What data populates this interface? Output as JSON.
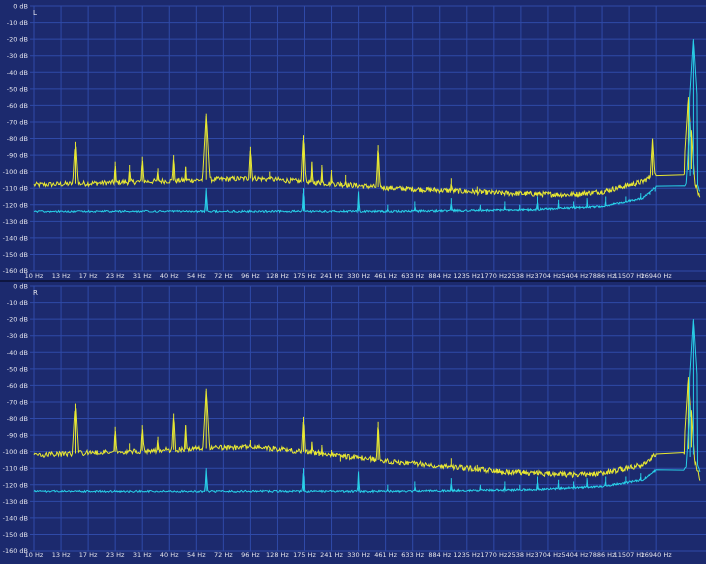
{
  "colors": {
    "background": "#1c2a6e",
    "grid": "#2f4aa8",
    "tick_text": "#e8e8f0",
    "trace_yellow": "#e8e832",
    "trace_cyan": "#28d0e8"
  },
  "chart_data": [
    {
      "type": "line",
      "channel_label": "L",
      "x_scale": "log",
      "xlim": [
        10,
        22000
      ],
      "ylim": [
        -160,
        0
      ],
      "grid": true,
      "y_ticks": [
        "0 dB",
        "-10 dB",
        "-20 dB",
        "-30 dB",
        "-40 dB",
        "-50 dB",
        "-60 dB",
        "-70 dB",
        "-80 dB",
        "-90 dB",
        "-100 dB",
        "-110 dB",
        "-120 dB",
        "-130 dB",
        "-140 dB",
        "-150 dB",
        "-160 dB"
      ],
      "x_ticks": [
        "10 Hz",
        "13 Hz",
        "17 Hz",
        "23 Hz",
        "31 Hz",
        "40 Hz",
        "54 Hz",
        "72 Hz",
        "96 Hz",
        "128 Hz",
        "175 Hz",
        "241 Hz",
        "330 Hz",
        "461 Hz",
        "633 Hz",
        "884 Hz",
        "1235 Hz",
        "1770 Hz",
        "2538 Hz",
        "3704 Hz",
        "5404 Hz",
        "7886 Hz",
        "11507 Hz",
        "16940 Hz"
      ],
      "series": [
        {
          "color": "#e8e832",
          "baseline": [
            [
              10,
              -108
            ],
            [
              100,
              -104
            ],
            [
              500,
              -110
            ],
            [
              2000,
              -113
            ],
            [
              5000,
              -114
            ],
            [
              8000,
              -112
            ],
            [
              14000,
              -106
            ],
            [
              17500,
              -100
            ],
            [
              19000,
              -98
            ],
            [
              21500,
              -117
            ]
          ],
          "peaks": [
            [
              15,
              -82
            ],
            [
              23,
              -94
            ],
            [
              27,
              -96
            ],
            [
              31,
              -91
            ],
            [
              36,
              -98
            ],
            [
              42,
              -90
            ],
            [
              48,
              -97
            ],
            [
              60,
              -65
            ],
            [
              96,
              -85
            ],
            [
              118,
              -100
            ],
            [
              173,
              -78
            ],
            [
              191,
              -94
            ],
            [
              215,
              -96
            ],
            [
              241,
              -99
            ],
            [
              267,
              -106
            ],
            [
              284,
              -102
            ],
            [
              420,
              -84
            ],
            [
              650,
              -112
            ],
            [
              1020,
              -104
            ],
            [
              1420,
              -109
            ],
            [
              16100,
              -80
            ],
            [
              18250,
              -55
            ],
            [
              19050,
              -75
            ]
          ]
        },
        {
          "color": "#28d0e8",
          "baseline": [
            [
              10,
              -124
            ],
            [
              500,
              -124
            ],
            [
              3000,
              -123
            ],
            [
              8000,
              -121
            ],
            [
              14000,
              -116
            ],
            [
              17500,
              -108
            ],
            [
              19300,
              -100
            ],
            [
              21500,
              -112
            ]
          ],
          "peaks": [
            [
              60,
              -110
            ],
            [
              173,
              -110
            ],
            [
              330,
              -112
            ],
            [
              473,
              -120
            ],
            [
              650,
              -118
            ],
            [
              1020,
              -116
            ],
            [
              1480,
              -120
            ],
            [
              2050,
              -118
            ],
            [
              2500,
              -120
            ],
            [
              3200,
              -115
            ],
            [
              4300,
              -117
            ],
            [
              5300,
              -118
            ],
            [
              6400,
              -116
            ],
            [
              8300,
              -115
            ],
            [
              11000,
              -115
            ],
            [
              13600,
              -113
            ],
            [
              15500,
              -114
            ],
            [
              16700,
              -112
            ],
            [
              18700,
              -70
            ],
            [
              19600,
              -20
            ]
          ]
        }
      ]
    },
    {
      "type": "line",
      "channel_label": "R",
      "x_scale": "log",
      "xlim": [
        10,
        22000
      ],
      "ylim": [
        -160,
        0
      ],
      "grid": true,
      "y_ticks": [
        "0 dB",
        "-10 dB",
        "-20 dB",
        "-30 dB",
        "-40 dB",
        "-50 dB",
        "-60 dB",
        "-70 dB",
        "-80 dB",
        "-90 dB",
        "-100 dB",
        "-110 dB",
        "-120 dB",
        "-130 dB",
        "-140 dB",
        "-150 dB",
        "-160 dB"
      ],
      "x_ticks": [
        "10 Hz",
        "13 Hz",
        "17 Hz",
        "23 Hz",
        "31 Hz",
        "40 Hz",
        "54 Hz",
        "72 Hz",
        "96 Hz",
        "128 Hz",
        "175 Hz",
        "241 Hz",
        "330 Hz",
        "461 Hz",
        "633 Hz",
        "884 Hz",
        "1235 Hz",
        "1770 Hz",
        "2538 Hz",
        "3704 Hz",
        "5404 Hz",
        "7886 Hz",
        "11507 Hz",
        "16940 Hz"
      ],
      "series": [
        {
          "color": "#e8e832",
          "baseline": [
            [
              10,
              -102
            ],
            [
              100,
              -97
            ],
            [
              500,
              -106
            ],
            [
              2000,
              -112
            ],
            [
              5000,
              -114
            ],
            [
              8000,
              -113
            ],
            [
              14000,
              -108
            ],
            [
              17500,
              -100
            ],
            [
              19000,
              -97
            ],
            [
              21500,
              -117
            ]
          ],
          "peaks": [
            [
              15,
              -71
            ],
            [
              23,
              -85
            ],
            [
              27,
              -95
            ],
            [
              31,
              -84
            ],
            [
              36,
              -91
            ],
            [
              42,
              -77
            ],
            [
              48,
              -84
            ],
            [
              60,
              -62
            ],
            [
              96,
              -93
            ],
            [
              118,
              -100
            ],
            [
              173,
              -79
            ],
            [
              191,
              -94
            ],
            [
              215,
              -96
            ],
            [
              241,
              -99
            ],
            [
              267,
              -106
            ],
            [
              284,
              -102
            ],
            [
              420,
              -82
            ],
            [
              650,
              -108
            ],
            [
              1020,
              -104
            ],
            [
              1420,
              -108
            ],
            [
              16100,
              -103
            ],
            [
              18250,
              -55
            ],
            [
              19050,
              -75
            ]
          ]
        },
        {
          "color": "#28d0e8",
          "baseline": [
            [
              10,
              -124
            ],
            [
              500,
              -124
            ],
            [
              3000,
              -123
            ],
            [
              8000,
              -121
            ],
            [
              14000,
              -117
            ],
            [
              17500,
              -110
            ],
            [
              19300,
              -100
            ],
            [
              21500,
              -112
            ]
          ],
          "peaks": [
            [
              60,
              -110
            ],
            [
              173,
              -110
            ],
            [
              330,
              -112
            ],
            [
              473,
              -120
            ],
            [
              650,
              -118
            ],
            [
              1020,
              -116
            ],
            [
              1480,
              -120
            ],
            [
              2050,
              -118
            ],
            [
              2500,
              -120
            ],
            [
              3200,
              -115
            ],
            [
              4300,
              -117
            ],
            [
              5300,
              -118
            ],
            [
              6400,
              -116
            ],
            [
              8300,
              -115
            ],
            [
              11000,
              -115
            ],
            [
              13600,
              -113
            ],
            [
              15500,
              -114
            ],
            [
              16700,
              -112
            ],
            [
              18700,
              -72
            ],
            [
              19600,
              -20
            ]
          ]
        }
      ]
    }
  ]
}
